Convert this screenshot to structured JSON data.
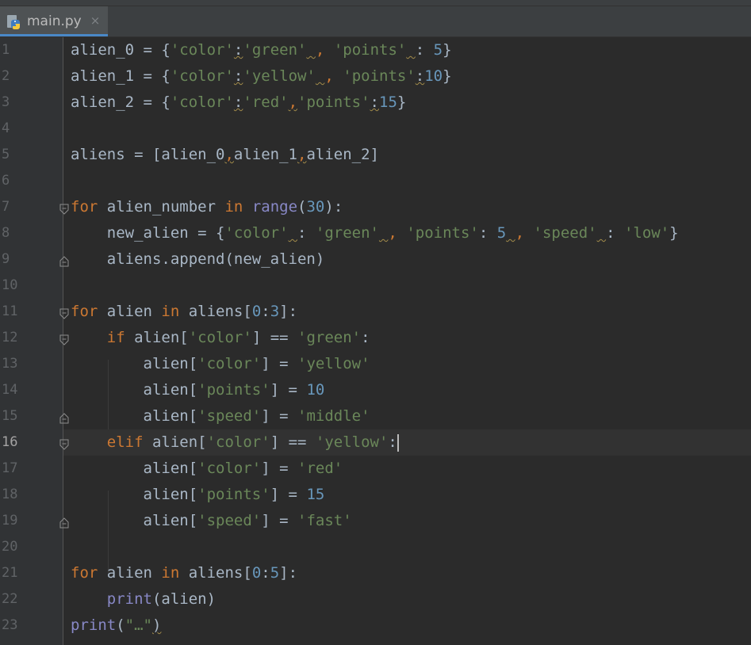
{
  "tab": {
    "filename": "main.py",
    "close_glyph": "×",
    "icon": "python-file-icon"
  },
  "editor": {
    "current_line": 16,
    "line_numbers": [
      "1",
      "2",
      "3",
      "4",
      "5",
      "6",
      "7",
      "8",
      "9",
      "10",
      "11",
      "12",
      "13",
      "14",
      "15",
      "16",
      "17",
      "18",
      "19",
      "20",
      "21",
      "22",
      "23"
    ]
  },
  "code": {
    "l1": {
      "a": "alien_0 = {",
      "b": "'color'",
      "c": ":",
      "d": "'green'",
      "e": " ",
      "f": ",",
      "g": " ",
      "h": "'points'",
      "i": " ",
      "j": ": ",
      "k": "5",
      "l": "}"
    },
    "l2": {
      "a": "alien_1 = {",
      "b": "'color'",
      "c": ":",
      "d": "'yellow'",
      "e": " ",
      "f": ",",
      "g": " ",
      "h": "'points'",
      "i": ":",
      "j": "10",
      "k": "}"
    },
    "l3": {
      "a": "alien_2 = {",
      "b": "'color'",
      "c": ":",
      "d": "'red'",
      "e": ",",
      "f": "'points'",
      "g": ":",
      "h": "15",
      "i": "}"
    },
    "l5": {
      "a": "aliens = [alien_0",
      "b": ",",
      "c": "alien_1",
      "d": ",",
      "e": "alien_2]"
    },
    "l7": {
      "a": "for",
      "b": " alien_number ",
      "c": "in",
      "d": " ",
      "e": "range",
      "f": "(",
      "g": "30",
      "h": "):"
    },
    "l8": {
      "a": "    new_alien = {",
      "b": "'color'",
      "c": " ",
      "d": ": ",
      "e": "'green'",
      "f": " ",
      "g": ",",
      "h": " ",
      "i": "'points'",
      "j": ": ",
      "k": "5",
      "l": " ",
      "m": ",",
      "n": " ",
      "o": "'speed'",
      "p": " ",
      "q": ": ",
      "r": "'low'",
      "s": "}"
    },
    "l9": {
      "a": "    aliens.append(new_alien)"
    },
    "l11": {
      "a": "for",
      "b": " alien ",
      "c": "in",
      "d": " aliens[",
      "e": "0",
      "f": ":",
      "g": "3",
      "h": "]:"
    },
    "l12": {
      "a": "    ",
      "b": "if",
      "c": " alien[",
      "d": "'color'",
      "e": "] == ",
      "f": "'green'",
      "g": ":"
    },
    "l13": {
      "a": "        alien[",
      "b": "'color'",
      "c": "] = ",
      "d": "'yellow'"
    },
    "l14": {
      "a": "        alien[",
      "b": "'points'",
      "c": "] = ",
      "d": "10"
    },
    "l15": {
      "a": "        alien[",
      "b": "'speed'",
      "c": "] = ",
      "d": "'middle'"
    },
    "l16": {
      "a": "    ",
      "b": "elif",
      "c": " alien[",
      "d": "'color'",
      "e": "] == ",
      "f": "'yellow'",
      "g": ":"
    },
    "l17": {
      "a": "        alien[",
      "b": "'color'",
      "c": "] = ",
      "d": "'red'"
    },
    "l18": {
      "a": "        alien[",
      "b": "'points'",
      "c": "] = ",
      "d": "15"
    },
    "l19": {
      "a": "        alien[",
      "b": "'speed'",
      "c": "] = ",
      "d": "'fast'"
    },
    "l21": {
      "a": "for",
      "b": " alien ",
      "c": "in",
      "d": " aliens[",
      "e": "0",
      "f": ":",
      "g": "5",
      "h": "]:"
    },
    "l22": {
      "a": "    ",
      "b": "print",
      "c": "(alien)"
    },
    "l23": {
      "a": "print",
      "b": "(",
      "c": "\"…\"",
      "d": ")"
    }
  },
  "colors": {
    "background": "#2b2b2b",
    "gutter": "#313335",
    "keyword": "#cc7832",
    "string": "#6a8759",
    "number": "#6897bb",
    "builtin": "#8888c6",
    "default": "#a9b7c6"
  }
}
